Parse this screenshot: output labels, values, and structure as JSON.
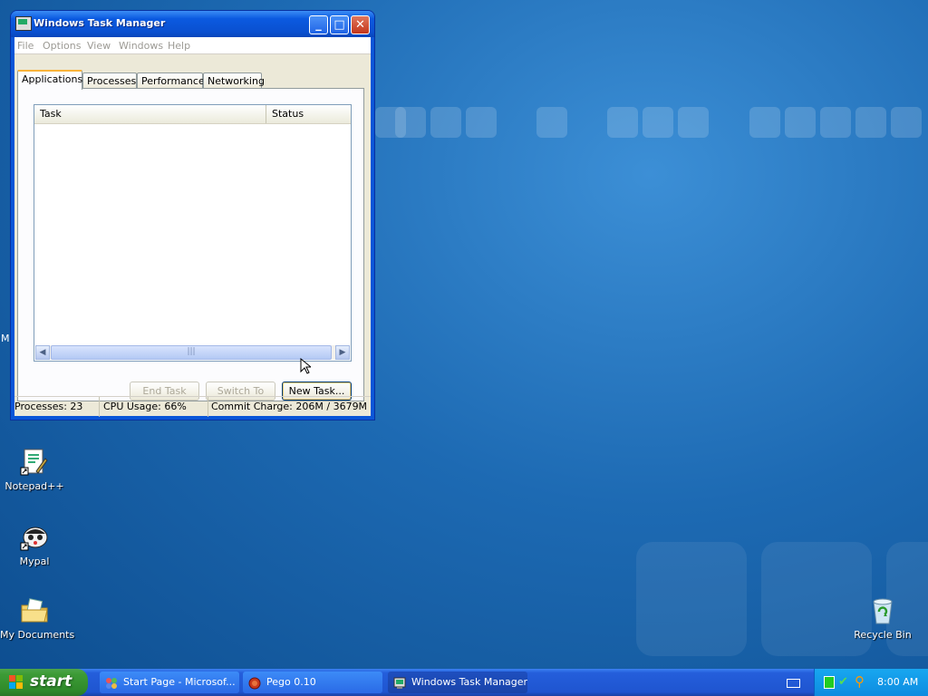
{
  "window": {
    "title": "Windows Task Manager",
    "menu": [
      "File",
      "Options",
      "View",
      "Windows",
      "Help"
    ],
    "tabs": [
      "Applications",
      "Processes",
      "Performance",
      "Networking"
    ],
    "active_tab": "Applications",
    "columns": [
      "Task",
      "Status"
    ],
    "buttons": {
      "end_task": "End Task",
      "switch_to": "Switch To",
      "new_task": "New Task..."
    },
    "status": {
      "processes": "Processes: 23",
      "cpu": "CPU Usage: 66%",
      "commit": "Commit Charge: 206M / 3679M"
    }
  },
  "desktop": {
    "icons": [
      "Notepad++",
      "Mypal",
      "My Documents",
      "Recycle Bin"
    ],
    "partial_label": "M"
  },
  "taskbar": {
    "start_label": "start",
    "tasks": [
      "Start Page - Microsof...",
      "Pego 0.10",
      "Windows Task Manager"
    ],
    "clock": "8:00 AM"
  },
  "colors": {
    "titlebar": "#0a56d8",
    "desktop": "#1d6ab3",
    "start_button": "#3d9b36",
    "tray": "#0d8be0"
  }
}
